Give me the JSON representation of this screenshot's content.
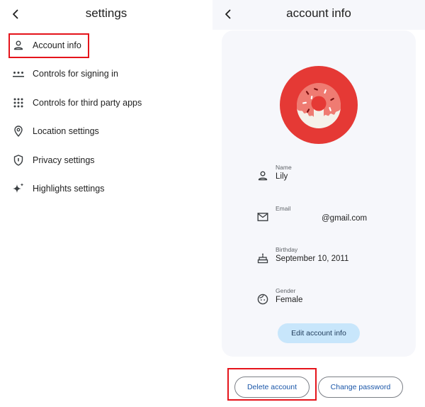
{
  "settings_screen": {
    "title": "settings",
    "items": [
      {
        "label": "Account info",
        "icon": "person-icon"
      },
      {
        "label": "Controls for signing in",
        "icon": "password-dots-icon"
      },
      {
        "label": "Controls for third party apps",
        "icon": "apps-grid-icon"
      },
      {
        "label": "Location settings",
        "icon": "location-pin-icon"
      },
      {
        "label": "Privacy settings",
        "icon": "shield-icon"
      },
      {
        "label": "Highlights settings",
        "icon": "sparkle-icon"
      }
    ]
  },
  "account_screen": {
    "title": "account info",
    "avatar": "donut-avatar",
    "fields": {
      "name": {
        "label": "Name",
        "value": "Lily"
      },
      "email": {
        "label": "Email",
        "value": "@gmail.com"
      },
      "birthday": {
        "label": "Birthday",
        "value": "September 10, 2011"
      },
      "gender": {
        "label": "Gender",
        "value": "Female"
      }
    },
    "edit_label": "Edit account info",
    "delete_label": "Delete account",
    "change_password_label": "Change password"
  },
  "colors": {
    "highlight": "#e5141b",
    "avatar_bg": "#e53935",
    "edit_button_bg": "#c8e6fb",
    "card_bg": "#f6f7fb"
  }
}
